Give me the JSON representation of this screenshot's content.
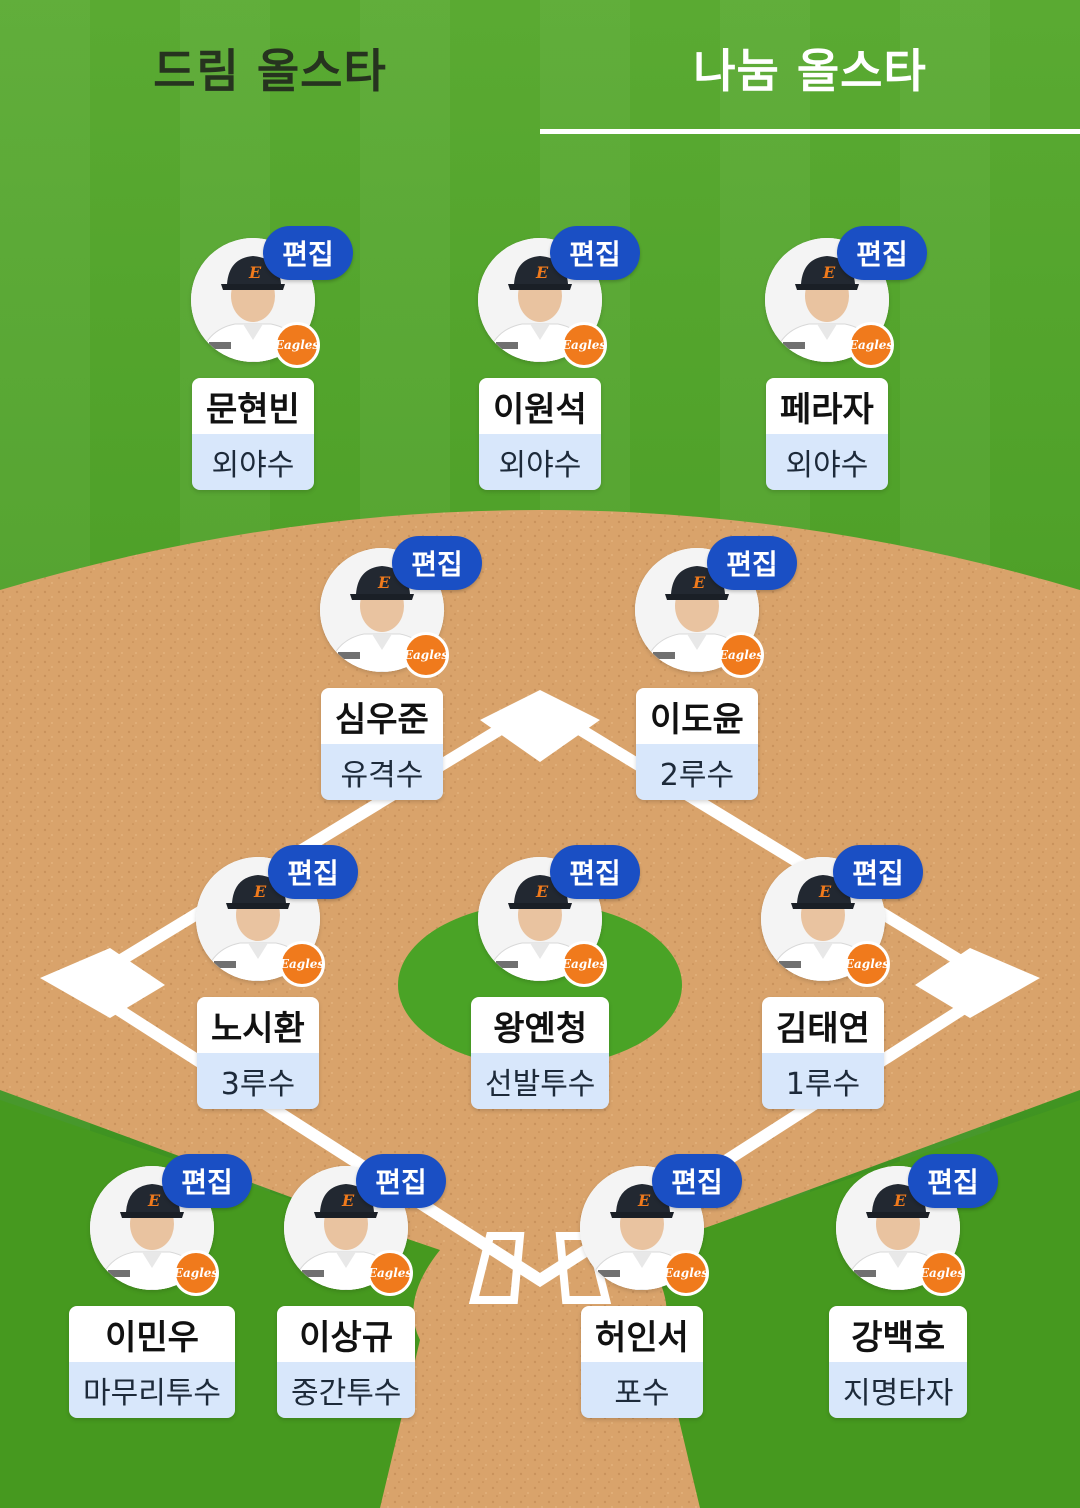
{
  "tabs": [
    {
      "label": "드림 올스타",
      "active": false
    },
    {
      "label": "나눔 올스타",
      "active": true
    }
  ],
  "edit_label": "편집",
  "team_logo_text": "Eagles",
  "colors": {
    "edit_button": "#1a4fc4",
    "position_bg": "#d8e7fb",
    "grass": "#4ea028",
    "infield_dirt": "#d9a36b",
    "team_logo": "#f07a1c"
  },
  "players": [
    {
      "id": "p1",
      "name": "문현빈",
      "position": "외야수"
    },
    {
      "id": "p2",
      "name": "이원석",
      "position": "외야수"
    },
    {
      "id": "p3",
      "name": "페라자",
      "position": "외야수"
    },
    {
      "id": "p4",
      "name": "심우준",
      "position": "유격수"
    },
    {
      "id": "p5",
      "name": "이도윤",
      "position": "2루수"
    },
    {
      "id": "p6",
      "name": "노시환",
      "position": "3루수"
    },
    {
      "id": "p7",
      "name": "왕옌청",
      "position": "선발투수"
    },
    {
      "id": "p8",
      "name": "김태연",
      "position": "1루수"
    },
    {
      "id": "p9",
      "name": "이민우",
      "position": "마무리투수"
    },
    {
      "id": "p10",
      "name": "이상규",
      "position": "중간투수"
    },
    {
      "id": "p11",
      "name": "허인서",
      "position": "포수"
    },
    {
      "id": "p12",
      "name": "강백호",
      "position": "지명타자"
    }
  ]
}
